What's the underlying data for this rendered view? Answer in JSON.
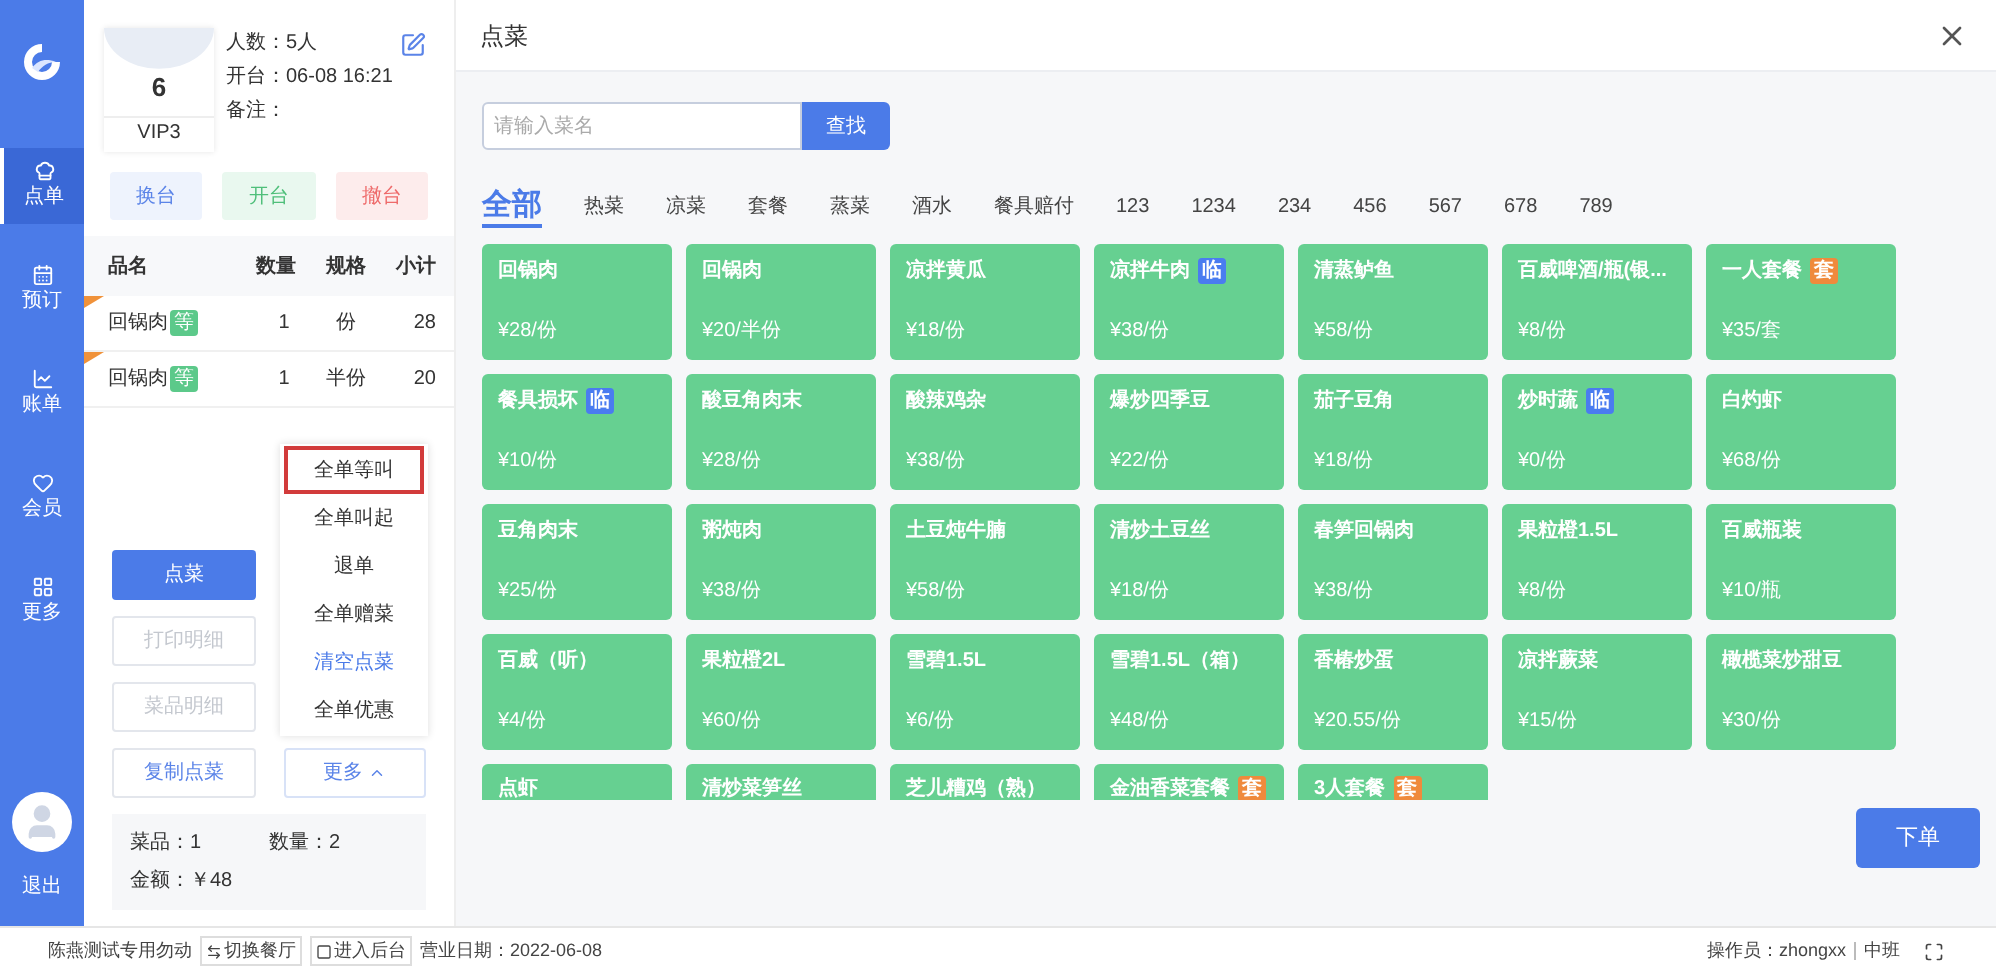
{
  "nav": {
    "items": [
      {
        "label": "点单",
        "selected": true
      },
      {
        "label": "预订",
        "selected": false
      },
      {
        "label": "账单",
        "selected": false
      },
      {
        "label": "会员",
        "selected": false
      },
      {
        "label": "更多",
        "selected": false
      }
    ],
    "logout": "退出"
  },
  "table": {
    "number": "6",
    "level": "VIP3",
    "people": "人数：5人",
    "opened": "开台：06-08 16:21",
    "note": "备注：",
    "actions": [
      {
        "label": "换台",
        "kind": "blue"
      },
      {
        "label": "开台",
        "kind": "green"
      },
      {
        "label": "撤台",
        "kind": "red"
      }
    ]
  },
  "order": {
    "columns": [
      "品名",
      "数量",
      "规格",
      "小计"
    ],
    "rows": [
      {
        "name": "回锅肉",
        "tag": "等",
        "qty": "1",
        "spec": "份",
        "subtotal": "28"
      },
      {
        "name": "回锅肉",
        "tag": "等",
        "qty": "1",
        "spec": "半份",
        "subtotal": "20"
      }
    ]
  },
  "buttons": [
    {
      "label": "点菜",
      "kind": "primary",
      "disabled": false
    },
    {
      "label": "打印明细",
      "kind": "plain",
      "disabled": true
    },
    {
      "label": "菜品明细",
      "kind": "plain",
      "disabled": true
    },
    {
      "label": "复制点菜",
      "kind": "plain",
      "disabled": false
    }
  ],
  "more_button": {
    "label": "更多",
    "expanded": true
  },
  "more_menu": [
    {
      "label": "全单等叫",
      "selected": true,
      "kind": "normal"
    },
    {
      "label": "全单叫起",
      "selected": false,
      "kind": "normal"
    },
    {
      "label": "退单",
      "selected": false,
      "kind": "normal"
    },
    {
      "label": "全单赠菜",
      "selected": false,
      "kind": "normal"
    },
    {
      "label": "清空点菜",
      "selected": false,
      "kind": "link"
    },
    {
      "label": "全单优惠",
      "selected": false,
      "kind": "normal"
    }
  ],
  "summary": {
    "dishes": "菜品：1",
    "count": "数量：2",
    "amount": "金额：￥48"
  },
  "dialog": {
    "title": "点菜",
    "search": {
      "placeholder": "请输入菜名",
      "button": "查找"
    },
    "categories": [
      {
        "label": "全部",
        "selected": true
      },
      {
        "label": "热菜",
        "selected": false
      },
      {
        "label": "凉菜",
        "selected": false
      },
      {
        "label": "套餐",
        "selected": false
      },
      {
        "label": "蒸菜",
        "selected": false
      },
      {
        "label": "酒水",
        "selected": false
      },
      {
        "label": "餐具赔付",
        "selected": false
      },
      {
        "label": "123",
        "selected": false
      },
      {
        "label": "1234",
        "selected": false
      },
      {
        "label": "234",
        "selected": false
      },
      {
        "label": "456",
        "selected": false
      },
      {
        "label": "567",
        "selected": false
      },
      {
        "label": "678",
        "selected": false
      },
      {
        "label": "789",
        "selected": false
      }
    ],
    "dishes": [
      {
        "name": "回锅肉",
        "price": "¥28/份"
      },
      {
        "name": "回锅肉",
        "price": "¥20/半份"
      },
      {
        "name": "凉拌黄瓜",
        "price": "¥18/份"
      },
      {
        "name": "凉拌牛肉",
        "price": "¥38/份",
        "tag": {
          "text": "临",
          "kind": "temp"
        }
      },
      {
        "name": "清蒸鲈鱼",
        "price": "¥58/份"
      },
      {
        "name": "百威啤酒/瓶(银...",
        "price": "¥8/份"
      },
      {
        "name": "一人套餐",
        "price": "¥35/套",
        "tag": {
          "text": "套",
          "kind": "set"
        }
      },
      {
        "name": "餐具损坏",
        "price": "¥10/份",
        "tag": {
          "text": "临",
          "kind": "temp"
        }
      },
      {
        "name": "酸豆角肉末",
        "price": "¥28/份"
      },
      {
        "name": "酸辣鸡杂",
        "price": "¥38/份"
      },
      {
        "name": "爆炒四季豆",
        "price": "¥22/份"
      },
      {
        "name": "茄子豆角",
        "price": "¥18/份"
      },
      {
        "name": "炒时蔬",
        "price": "¥0/份",
        "tag": {
          "text": "临",
          "kind": "temp"
        }
      },
      {
        "name": "白灼虾",
        "price": "¥68/份"
      },
      {
        "name": "豆角肉末",
        "price": "¥25/份"
      },
      {
        "name": "粥炖肉",
        "price": "¥38/份"
      },
      {
        "name": "土豆炖牛腩",
        "price": "¥58/份"
      },
      {
        "name": "清炒土豆丝",
        "price": "¥18/份"
      },
      {
        "name": "春笋回锅肉",
        "price": "¥38/份"
      },
      {
        "name": "果粒橙1.5L",
        "price": "¥8/份"
      },
      {
        "name": "百威瓶装",
        "price": "¥10/瓶"
      },
      {
        "name": "百威（听）",
        "price": "¥4/份"
      },
      {
        "name": "果粒橙2L",
        "price": "¥60/份"
      },
      {
        "name": "雪碧1.5L",
        "price": "¥6/份"
      },
      {
        "name": "雪碧1.5L（箱）",
        "price": "¥48/份"
      },
      {
        "name": "香椿炒蛋",
        "price": "¥20.55/份"
      },
      {
        "name": "凉拌蕨菜",
        "price": "¥15/份"
      },
      {
        "name": "橄榄菜炒甜豆",
        "price": "¥30/份"
      },
      {
        "name": "点虾"
      },
      {
        "name": "清炒菜笋丝"
      },
      {
        "name": "芝儿糟鸡（熟）"
      },
      {
        "name": "金油香菜套餐",
        "tag": {
          "text": "套",
          "kind": "set"
        }
      },
      {
        "name": "3人套餐",
        "tag": {
          "text": "套",
          "kind": "set"
        }
      }
    ],
    "submit": "下单"
  },
  "status_bar": {
    "store": "陈燕测试专用勿动",
    "switch": "切换餐厅",
    "backend": "进入后台",
    "date": "营业日期：2022-06-08",
    "operator": "操作员：zhongxx",
    "shift": "中班"
  }
}
